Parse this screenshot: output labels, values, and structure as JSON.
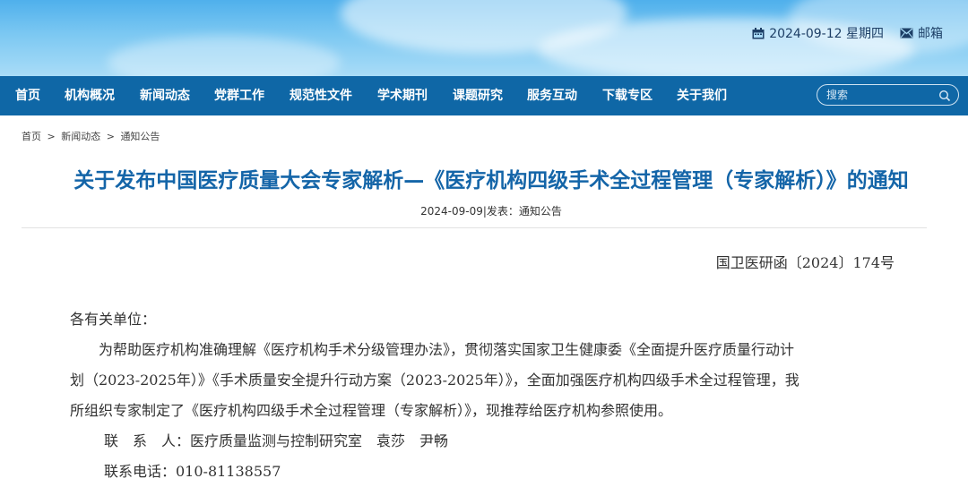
{
  "header": {
    "date": "2024-09-12 星期四",
    "mail_label": "邮箱",
    "calendar_icon": "calendar-icon",
    "mail_icon": "mail-icon"
  },
  "nav": {
    "items": [
      "首页",
      "机构概况",
      "新闻动态",
      "党群工作",
      "规范性文件",
      "学术期刊",
      "课题研究",
      "服务互动",
      "下载专区",
      "关于我们"
    ],
    "search_placeholder": "搜索",
    "search_icon": "search-icon"
  },
  "breadcrumb": [
    "首页",
    ">",
    "新闻动态",
    ">",
    "通知公告"
  ],
  "article": {
    "title": "关于发布中国医疗质量大会专家解析—《医疗机构四级手术全过程管理（专家解析）》的通知",
    "meta": "2024-09-09|发表：通知公告",
    "doc_number": "国卫医研函〔2024〕174号",
    "salutation": "各有关单位：",
    "paragraph_lines": [
      "为帮助医疗机构准确理解《医疗机构手术分级管理办法》，贯彻落实国家卫生健康委《全面提升医疗质量行动计",
      "划（2023-2025年）》《手术质量安全提升行动方案（2023-2025年）》，全面加强医疗机构四级手术全过程管理，我",
      "所组织专家制定了《医疗机构四级手术全过程管理（专家解析）》，现推荐给医疗机构参照使用。"
    ],
    "contact_person": "联　系　人：医疗质量监测与控制研究室　袁莎　尹畅",
    "contact_phone": "联系电话：010-81138557"
  },
  "colors": {
    "nav_bg": "#0f67a6",
    "title": "#1465a8",
    "banner_top": "#4fb0ec"
  }
}
